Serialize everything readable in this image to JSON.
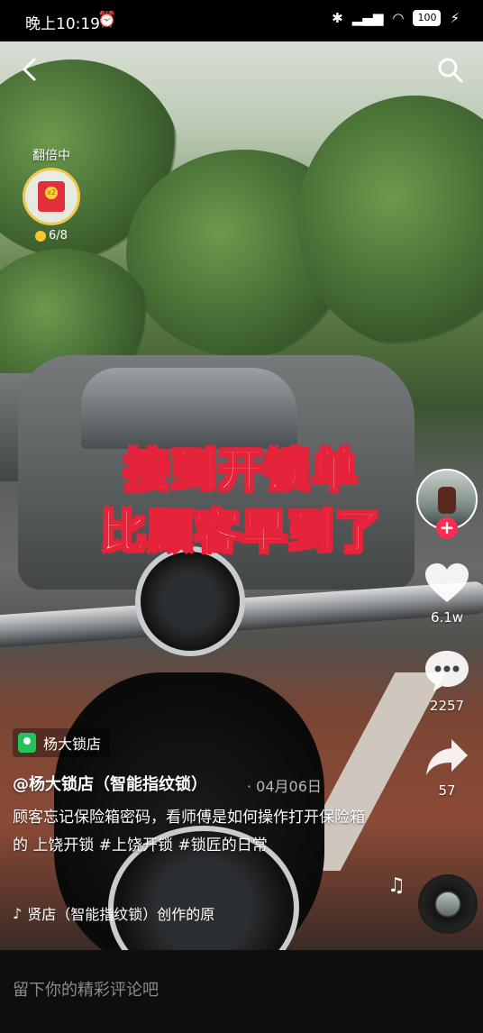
{
  "status_bar": {
    "time": "晚上10:19",
    "battery": "100"
  },
  "reward": {
    "label": "翻倍中",
    "progress": "6/8",
    "multiplier": "x2"
  },
  "overlay": {
    "line1": "接到开锁单",
    "line2": "比顾客早到了"
  },
  "rail": {
    "follow_symbol": "+",
    "likes": "6.1w",
    "comments": "2257",
    "shares": "57"
  },
  "location": {
    "label": "杨大锁店"
  },
  "post": {
    "author": "@杨大锁店（智能指纹锁）",
    "date": "· 04月06日",
    "description": "顾客忘记保险箱密码，看师傅是如何操作打开保险箱的 上饶开锁 #上饶开锁 #锁匠的日常",
    "music": "贤店（智能指纹锁）创作的原"
  },
  "comment": {
    "placeholder": "留下你的精彩评论吧"
  },
  "colors": {
    "accent": "#fe2c55",
    "caption_stroke": "#e5233b",
    "location_green": "#22c45a"
  },
  "icons": [
    "back-icon",
    "search-icon",
    "heart-icon",
    "comment-icon",
    "share-icon",
    "music-note-icon",
    "tiktok-icon",
    "location-pin-icon"
  ]
}
